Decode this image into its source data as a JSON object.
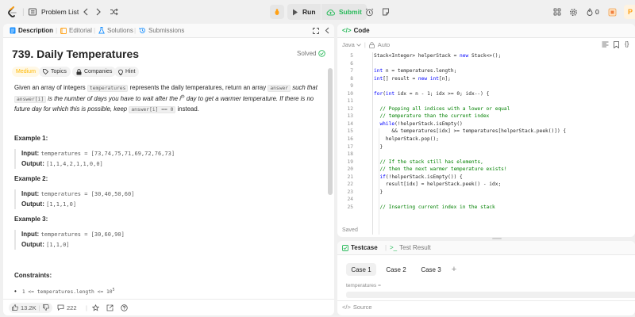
{
  "topbar": {
    "problem_list": "Problem List",
    "run": "Run",
    "submit": "Submit",
    "streak": "0",
    "premium": "P"
  },
  "colors": {
    "accent": "#ffa116",
    "green": "#2cbb5d",
    "orange_bg": "#fff3e0",
    "link": "#0000ff"
  },
  "left_tabs": [
    "Description",
    "Editorial",
    "Solutions",
    "Submissions"
  ],
  "problem": {
    "title": "739. Daily Temperatures",
    "status": "Solved",
    "tags": [
      "Medium",
      "Topics",
      "Companies",
      "Hint"
    ],
    "desc": {
      "p1": "Given an array of integers ",
      "c1": "temperatures",
      "p2": " represents the daily temperatures, return an array ",
      "c2": "answer",
      "p3": " such that ",
      "c3": "answer[i]",
      "p4": " is the number of days you have to wait after the ",
      "p5": "i",
      "p6": "th",
      "p7": " day to get a warmer temperature. If there is no future day for which this is possible, keep ",
      "c4": "answer[i] == 0",
      "p8": " instead."
    },
    "examples": [
      {
        "title": "Example 1:",
        "input_label": "Input:",
        "input": "temperatures = [73,74,75,71,69,72,76,73]",
        "output_label": "Output:",
        "output": "[1,1,4,2,1,1,0,0]"
      },
      {
        "title": "Example 2:",
        "input_label": "Input:",
        "input": "temperatures = [30,40,50,60]",
        "output_label": "Output:",
        "output": "[1,1,1,0]"
      },
      {
        "title": "Example 3:",
        "input_label": "Input:",
        "input": "temperatures = [30,60,90]",
        "output_label": "Output:",
        "output": "[1,1,0]"
      }
    ],
    "constraints_title": "Constraints:",
    "constraint1": "1 <= temperatures.length <= 10",
    "constraint1_exp": "5",
    "likes": "13.2K",
    "comments": "222"
  },
  "code_panel": {
    "title": "Code",
    "language": "Java",
    "auto": "Auto",
    "saved": "Saved",
    "lines": [
      {
        "n": "5",
        "t": "Stack<Integer> helperStack = new Stack<>();",
        "k": ""
      },
      {
        "n": "6",
        "t": "",
        "k": ""
      },
      {
        "n": "7",
        "t": "int n = temperatures.length;",
        "k": ""
      },
      {
        "n": "8",
        "t": "int[] result = new int[n];",
        "k": ""
      },
      {
        "n": "9",
        "t": "",
        "k": ""
      },
      {
        "n": "10",
        "t": "for(int idx = n - 1; idx >= 0; idx--) {",
        "k": ""
      },
      {
        "n": "11",
        "t": "",
        "k": ""
      },
      {
        "n": "12",
        "t": "  // Popping all indices with a lower or equal",
        "k": "cm"
      },
      {
        "n": "13",
        "t": "  // temperature than the current index",
        "k": "cm"
      },
      {
        "n": "14",
        "t": "  while(!helperStack.isEmpty()",
        "k": ""
      },
      {
        "n": "15",
        "t": "      && temperatures[idx] >= temperatures[helperStack.peek()]) {",
        "k": ""
      },
      {
        "n": "16",
        "t": "    helperStack.pop();",
        "k": ""
      },
      {
        "n": "17",
        "t": "  }",
        "k": ""
      },
      {
        "n": "18",
        "t": "",
        "k": ""
      },
      {
        "n": "19",
        "t": "  // If the stack still has elements,",
        "k": "cm"
      },
      {
        "n": "20",
        "t": "  // then the next warmer temperature exists!",
        "k": "cm"
      },
      {
        "n": "21",
        "t": "  if(!helperStack.isEmpty()) {",
        "k": ""
      },
      {
        "n": "22",
        "t": "    result[idx] = helperStack.peek() - idx;",
        "k": ""
      },
      {
        "n": "23",
        "t": "  }",
        "k": ""
      },
      {
        "n": "24",
        "t": "",
        "k": ""
      },
      {
        "n": "25",
        "t": "  // Inserting current index in the stack",
        "k": "cm"
      }
    ]
  },
  "test_panel": {
    "testcase": "Testcase",
    "test_result": "Test Result",
    "cases": [
      "Case 1",
      "Case 2",
      "Case 3"
    ],
    "add": "+",
    "var_label": "temperatures =",
    "source": "Source"
  }
}
